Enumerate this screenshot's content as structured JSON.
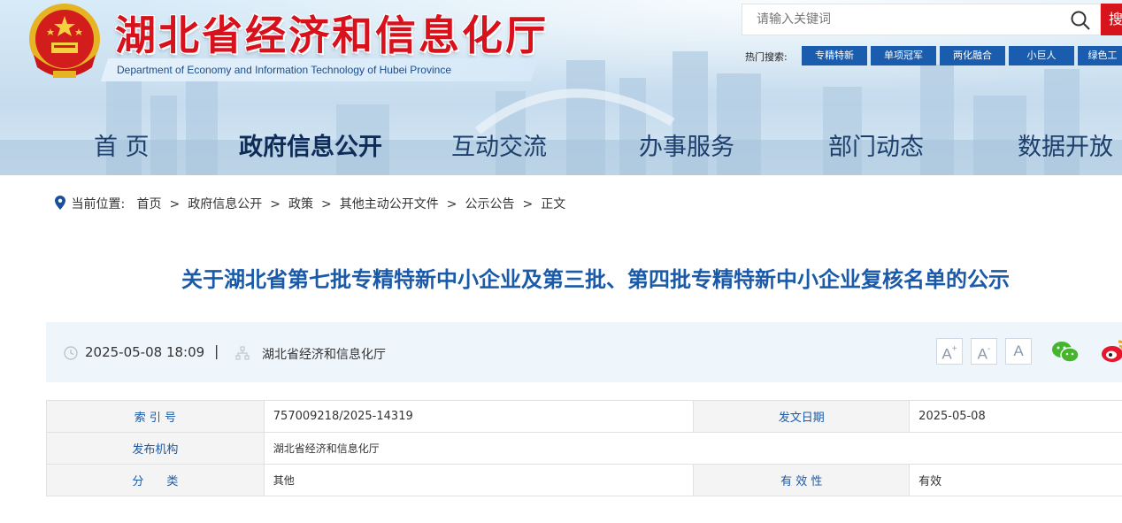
{
  "header": {
    "site_title": "湖北省经济和信息化厅",
    "site_subtitle": "Department of Economy and Information Technology of Hubei Province"
  },
  "search": {
    "placeholder": "请输入关键词",
    "button_label": "搜"
  },
  "hot_search": {
    "label": "热门搜索:",
    "tags": [
      "专精特新",
      "单项冠军",
      "两化融合",
      "小巨人",
      "绿色工"
    ]
  },
  "nav": {
    "items": [
      "首 页",
      "政府信息公开",
      "互动交流",
      "办事服务",
      "部门动态",
      "数据开放"
    ],
    "active_index": 1
  },
  "breadcrumb": {
    "prefix": "当前位置:",
    "separator": ">",
    "items": [
      "首页",
      "政府信息公开",
      "政策",
      "其他主动公开文件",
      "公示公告",
      "正文"
    ]
  },
  "article": {
    "title": "关于湖北省第七批专精特新中小企业及第三批、第四批专精特新中小企业复核名单的公示",
    "publish_time": "2025-05-08 18:09",
    "divider": "|",
    "publisher": "湖北省经济和信息化厅"
  },
  "tools": {
    "font_larger": "A",
    "font_larger_sup": "+",
    "font_smaller": "A",
    "font_smaller_sup": "-",
    "font_default": "A"
  },
  "info_table": {
    "rows": [
      {
        "label1": "索 引 号",
        "value1": "757009218/2025-14319",
        "label2": "发文日期",
        "value2": "2025-05-08"
      },
      {
        "label1": "发布机构",
        "value1": "湖北省经济和信息化厅"
      },
      {
        "label1": "分　　类",
        "value1": "其他",
        "label2": "有 效 性",
        "value2": "有效"
      }
    ]
  },
  "colors": {
    "brand_red": "#d8121c",
    "brand_blue": "#1a5cae",
    "title_blue": "#1a5aa8"
  }
}
